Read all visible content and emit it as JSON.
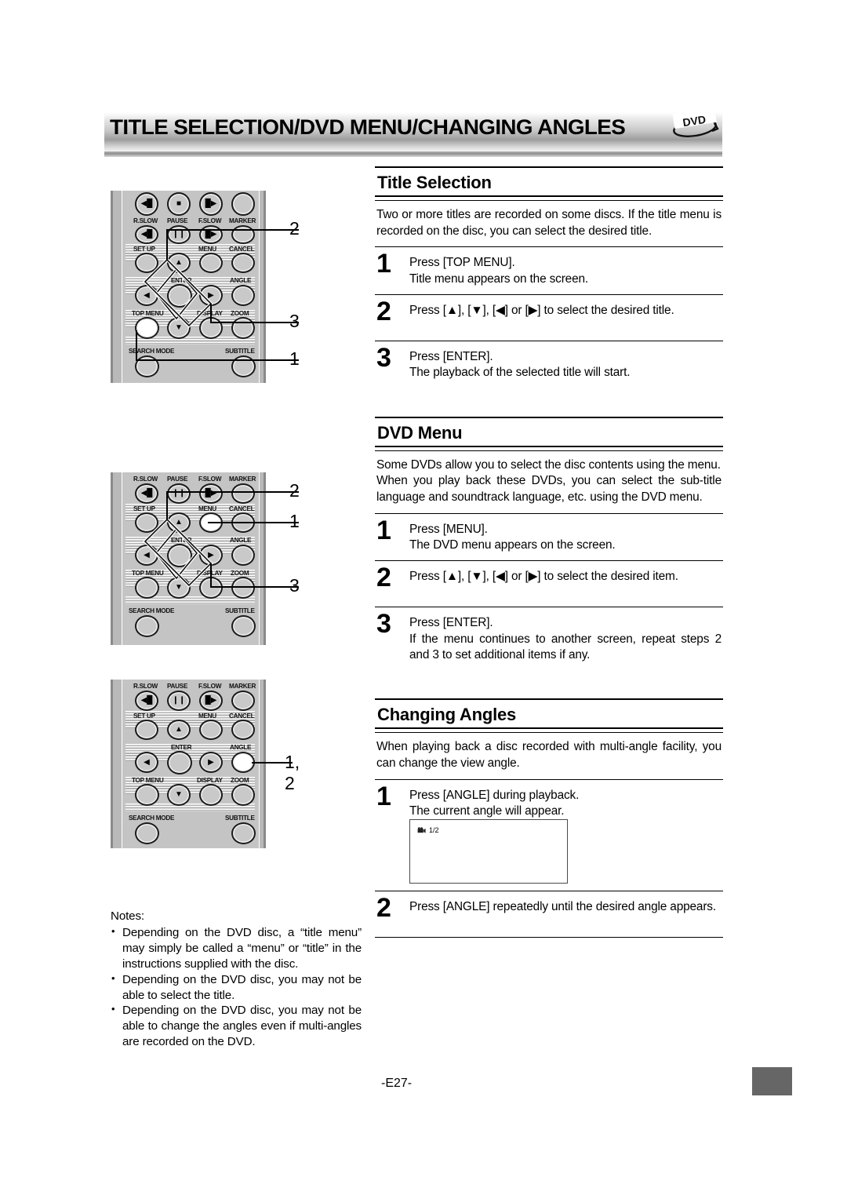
{
  "header": {
    "title": "TITLE SELECTION/DVD MENU/CHANGING ANGLES",
    "logo_label": "DVD",
    "logo_icon": "dvd-disc-logo"
  },
  "sections": [
    {
      "id": "title-selection",
      "heading": "Title Selection",
      "intro": "Two or more titles are recorded on some discs. If the title menu is recorded on the disc, you can select the desired title.",
      "steps": [
        {
          "num": "1",
          "line1": "Press [TOP MENU].",
          "line2": "Title menu appears on the screen."
        },
        {
          "num": "2",
          "line1": "Press [▲], [▼], [◀] or [▶] to select the desired title.",
          "line2": ""
        },
        {
          "num": "3",
          "line1": "Press [ENTER].",
          "line2": "The playback of the selected title will start."
        }
      ]
    },
    {
      "id": "dvd-menu",
      "heading": "DVD Menu",
      "intro_p1": "Some DVDs allow you to select the disc contents using the menu.",
      "intro_p2": "When you play back these DVDs, you can select the sub-title language and soundtrack language, etc. using the DVD menu.",
      "steps": [
        {
          "num": "1",
          "line1": "Press [MENU].",
          "line2": "The DVD menu appears on the screen."
        },
        {
          "num": "2",
          "line1": "Press [▲], [▼], [◀] or [▶] to select the desired item.",
          "line2": ""
        },
        {
          "num": "3",
          "line1": "Press [ENTER].",
          "line2": "If the menu continues to another screen, repeat steps 2 and 3 to set additional items if any."
        }
      ]
    },
    {
      "id": "changing-angles",
      "heading": "Changing Angles",
      "intro": "When playing back a disc recorded with multi-angle facility, you can change the view angle.",
      "steps": [
        {
          "num": "1",
          "line1": "Press [ANGLE] during playback.",
          "line2": "The current angle will appear."
        },
        {
          "num": "2",
          "line1": "Press [ANGLE] repeatedly until the desired angle appears.",
          "line2": ""
        }
      ],
      "osd": {
        "icon": "camera-angle-icon",
        "value": "1/2"
      }
    }
  ],
  "notes": {
    "label": "Notes:",
    "items": [
      "Depending on the DVD disc, a “title menu” may simply be called a “menu” or “title” in the instructions supplied with the disc.",
      "Depending on the DVD disc, you may not be able to select the title.",
      "Depending on the DVD disc, you may not be able to change the angles even if multi-angles are recorded on the DVD."
    ]
  },
  "footer": {
    "page_number": "-E27-"
  },
  "remote": {
    "button_labels": {
      "r_slow": "R.SLOW",
      "pause": "PAUSE",
      "f_slow": "F.SLOW",
      "marker": "MARKER",
      "setup": "SET UP",
      "menu": "MENU",
      "cancel": "CANCEL",
      "enter": "ENTER",
      "angle": "ANGLE",
      "top_menu": "TOP MENU",
      "display": "DISPLAY",
      "zoom": "ZOOM",
      "search_mode": "SEARCH MODE",
      "subtitle": "SUBTITLE"
    },
    "glyphs": {
      "rew": "◀█",
      "stop": "■",
      "ff": "█▶",
      "up": "▲",
      "down": "▼",
      "left": "◀",
      "right": "▶",
      "pause_bars": "❙❙"
    }
  },
  "figures": [
    {
      "id": "figure-title-selection",
      "callouts": [
        {
          "label": "2",
          "target": "cursor-pad"
        },
        {
          "label": "3",
          "target": "enter-button"
        },
        {
          "label": "1",
          "target": "top-menu-button"
        }
      ],
      "highlighted_buttons": [
        "top-menu-button"
      ]
    },
    {
      "id": "figure-dvd-menu",
      "callouts": [
        {
          "label": "2",
          "target": "cursor-pad"
        },
        {
          "label": "1",
          "target": "menu-button"
        },
        {
          "label": "3",
          "target": "enter-button"
        }
      ],
      "highlighted_buttons": [
        "menu-button"
      ]
    },
    {
      "id": "figure-changing-angles",
      "callouts": [
        {
          "label": "1, 2",
          "target": "angle-button"
        }
      ],
      "highlighted_buttons": [
        "angle-button"
      ]
    }
  ]
}
